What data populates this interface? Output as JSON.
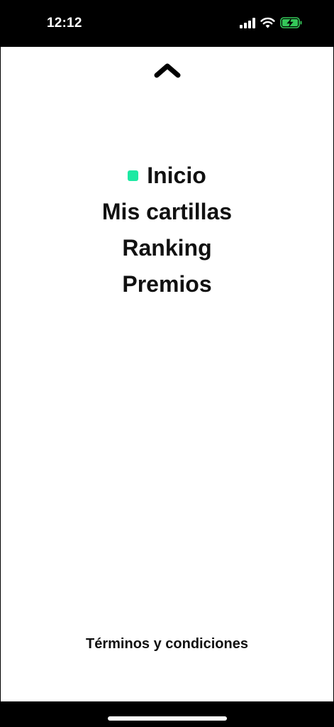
{
  "status_bar": {
    "time": "12:12",
    "signal_icon": "cellular-signal-icon",
    "wifi_icon": "wifi-icon",
    "battery_icon": "battery-charging-icon",
    "battery_color": "#34c759"
  },
  "nav": {
    "collapse_icon": "chevron-up-icon"
  },
  "menu": {
    "active_color": "#1de9a3",
    "items": [
      {
        "label": "Inicio",
        "active": true
      },
      {
        "label": "Mis cartillas",
        "active": false
      },
      {
        "label": "Ranking",
        "active": false
      },
      {
        "label": "Premios",
        "active": false
      }
    ]
  },
  "footer": {
    "terms_label": "Términos y condiciones"
  }
}
